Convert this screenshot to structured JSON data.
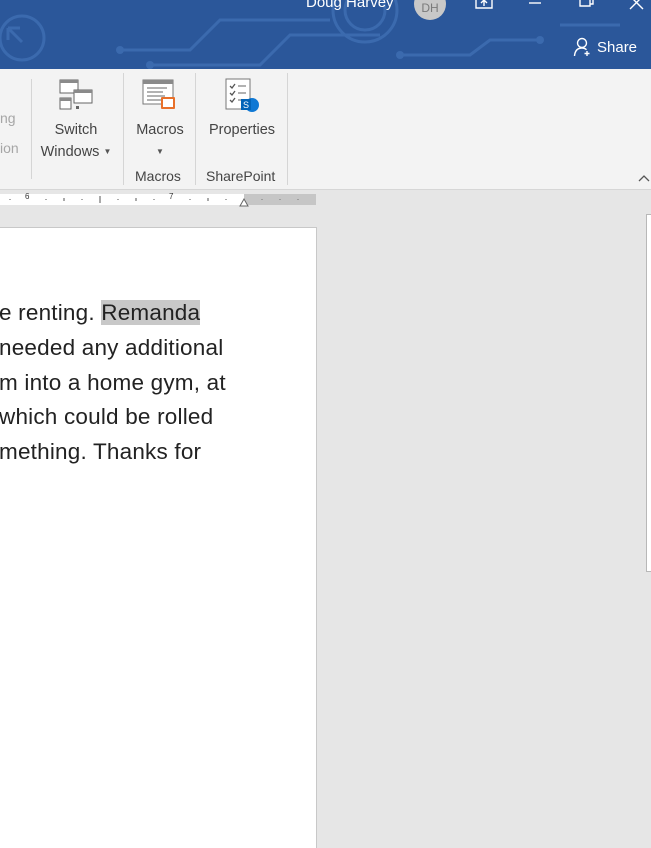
{
  "titlebar": {
    "user_name": "Doug Harvey",
    "user_initials": "DH",
    "share_label": "Share",
    "accent_color": "#2b579a"
  },
  "ribbon": {
    "cut_labels": [
      "ng",
      "ion"
    ],
    "switch_windows": {
      "line1": "Switch",
      "line2": "Windows"
    },
    "macros_button": "Macros",
    "macros_group": "Macros",
    "properties_button": "Properties",
    "sharepoint_group": "SharePoint"
  },
  "ruler": {
    "marks": [
      "6",
      "7"
    ]
  },
  "document": {
    "lines": [
      {
        "text": "e renting. ",
        "highlight": "Remanda"
      },
      {
        "text": "needed any additional"
      },
      {
        "text": "m into a home gym, at"
      },
      {
        "text": "which could be rolled"
      },
      {
        "text": "mething. Thanks for"
      }
    ]
  }
}
